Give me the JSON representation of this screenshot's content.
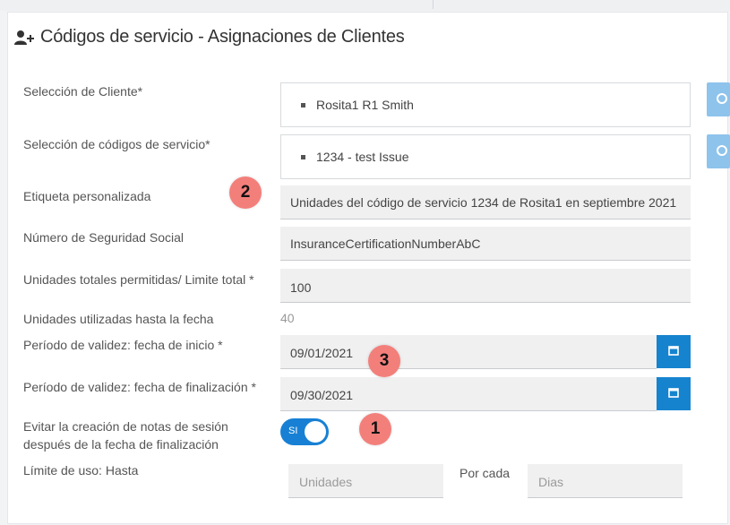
{
  "page": {
    "title": "Códigos de servicio - Asignaciones de Clientes",
    "title_icon": "add-user-icon"
  },
  "form": {
    "client_selection": {
      "label": "Selección de Cliente*",
      "value": "Rosita1 R1 Smith"
    },
    "service_codes": {
      "label": "Selección de códigos de servicio*",
      "value": "1234 - test Issue"
    },
    "custom_label": {
      "label": "Etiqueta personalizada",
      "value": "Unidades del código de servicio 1234 de Rosita1 en septiembre 2021"
    },
    "ssn": {
      "label": "Número de Seguridad Social",
      "value": "InsuranceCertificationNumberAbC"
    },
    "total_units": {
      "label": "Unidades totales permitidas/ Limite total  *",
      "value": "100"
    },
    "used_units": {
      "label": "Unidades utilizadas hasta la fecha",
      "value": "40"
    },
    "start_date": {
      "label": "Período de validez: fecha de inicio  *",
      "value": "09/01/2021",
      "icon": "calendar-icon"
    },
    "end_date": {
      "label": "Período de validez: fecha de finalización  *",
      "value": "09/30/2021",
      "icon": "calendar-icon"
    },
    "prevent_notes": {
      "label_line1": "Evitar la creación de notas de sesión",
      "label_line2": "después de la fecha de finalización",
      "toggle_text": "SI",
      "on": true
    },
    "usage_limit": {
      "label": "Límite de uso: Hasta",
      "units_placeholder": "Unidades",
      "per_label": "Por cada",
      "period_placeholder": "Dias"
    }
  },
  "annotations": {
    "one": "1",
    "two": "2",
    "three": "3"
  },
  "colors": {
    "accent": "#1683cf",
    "badge": "#f37f7b",
    "side_button": "#8ec3ec"
  }
}
